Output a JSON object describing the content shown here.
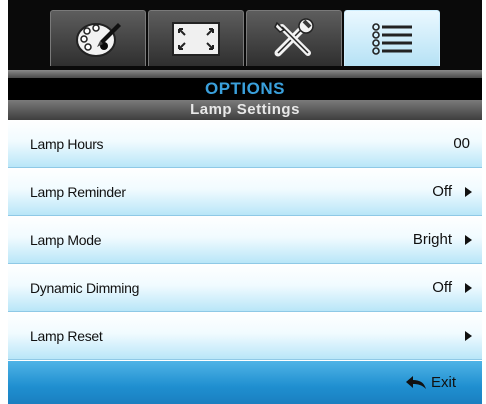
{
  "header": {
    "title": "OPTIONS"
  },
  "subheader": {
    "title": "Lamp Settings"
  },
  "tabs": [
    {
      "icon": "color-palette-icon",
      "active": false
    },
    {
      "icon": "screen-display-icon",
      "active": false
    },
    {
      "icon": "setup-tools-icon",
      "active": false
    },
    {
      "icon": "options-list-icon",
      "active": true
    }
  ],
  "rows": [
    {
      "label": "Lamp Hours",
      "value": "00",
      "arrow": false
    },
    {
      "label": "Lamp Reminder",
      "value": "Off",
      "arrow": true
    },
    {
      "label": "Lamp Mode",
      "value": "Bright",
      "arrow": true
    },
    {
      "label": "Dynamic Dimming",
      "value": "Off",
      "arrow": true
    },
    {
      "label": "Lamp Reset",
      "value": "",
      "arrow": true
    }
  ],
  "footer": {
    "exit_label": "Exit",
    "exit_icon": "return-arrow-icon"
  },
  "colors": {
    "accent": "#3aa0dc",
    "row_gradient_bottom": "#b9e6f8",
    "footer": "#1f8fd0"
  }
}
